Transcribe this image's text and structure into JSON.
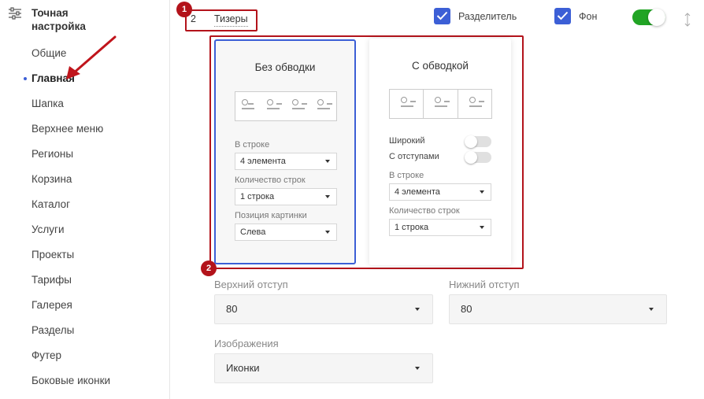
{
  "sidebar": {
    "title": "Точная настройка",
    "items": [
      {
        "label": "Общие"
      },
      {
        "label": "Главная"
      },
      {
        "label": "Шапка"
      },
      {
        "label": "Верхнее меню"
      },
      {
        "label": "Регионы"
      },
      {
        "label": "Корзина"
      },
      {
        "label": "Каталог"
      },
      {
        "label": "Услуги"
      },
      {
        "label": "Проекты"
      },
      {
        "label": "Тарифы"
      },
      {
        "label": "Галерея"
      },
      {
        "label": "Разделы"
      },
      {
        "label": "Футер"
      },
      {
        "label": "Боковые иконки"
      }
    ]
  },
  "annotations": {
    "badge1": "1",
    "badge2": "2",
    "color": "#b3131b"
  },
  "block": {
    "number": "2",
    "title": "Тизеры",
    "separator_label": "Разделитель",
    "separator_checked": true,
    "background_label": "Фон",
    "background_checked": true,
    "enabled": true,
    "accent_color": "#3c5fd6",
    "toggle_color": "#21a424"
  },
  "variants": [
    {
      "title": "Без обводки",
      "selected": true,
      "preview_columns": 4,
      "fields": [
        {
          "label": "В строке",
          "value": "4 элемента"
        },
        {
          "label": "Количество строк",
          "value": "1 строка"
        },
        {
          "label": "Позиция картинки",
          "value": "Слева"
        }
      ]
    },
    {
      "title": "С обводкой",
      "selected": false,
      "preview_columns": 3,
      "options": [
        {
          "label": "Широкий",
          "on": false
        },
        {
          "label": "С отступами",
          "on": false
        }
      ],
      "fields": [
        {
          "label": "В строке",
          "value": "4 элемента"
        },
        {
          "label": "Количество строк",
          "value": "1 строка"
        }
      ]
    }
  ],
  "settings": {
    "top_padding": {
      "label": "Верхний отступ",
      "value": "80"
    },
    "bottom_padding": {
      "label": "Нижний отступ",
      "value": "80"
    },
    "images": {
      "label": "Изображения",
      "value": "Иконки"
    }
  }
}
